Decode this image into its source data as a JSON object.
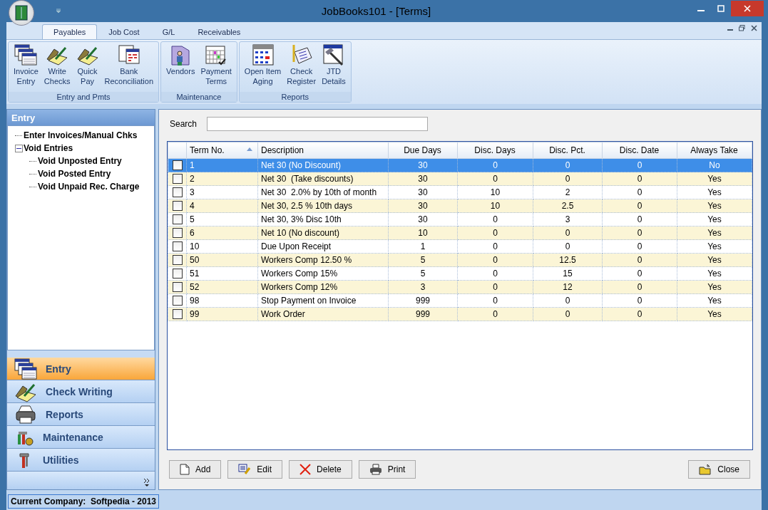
{
  "window": {
    "title": "JobBooks101 - [Terms]"
  },
  "ribbon": {
    "tabs": [
      {
        "label": "Payables",
        "selected": true
      },
      {
        "label": "Job Cost",
        "selected": false
      },
      {
        "label": "G/L",
        "selected": false
      },
      {
        "label": "Receivables",
        "selected": false
      }
    ],
    "groups": [
      {
        "label": "Entry and Pmts",
        "buttons": [
          {
            "lines": [
              "Invoice",
              "Entry"
            ]
          },
          {
            "lines": [
              "Write",
              "Checks"
            ]
          },
          {
            "lines": [
              "Quick",
              "Pay"
            ]
          },
          {
            "lines": [
              "Bank",
              "Reconciliation"
            ]
          }
        ]
      },
      {
        "label": "Maintenance",
        "buttons": [
          {
            "lines": [
              "Vendors"
            ]
          },
          {
            "lines": [
              "Payment",
              "Terms"
            ]
          }
        ]
      },
      {
        "label": "Reports",
        "buttons": [
          {
            "lines": [
              "Open Item",
              "Aging"
            ]
          },
          {
            "lines": [
              "Check",
              "Register"
            ]
          },
          {
            "lines": [
              "JTD",
              "Details"
            ]
          }
        ]
      }
    ]
  },
  "sidebar": {
    "header": "Entry",
    "tree": [
      {
        "label": "Enter Invoices/Manual Chks"
      },
      {
        "label": "Void Entries",
        "expanded": true,
        "children": [
          {
            "label": "Void Unposted Entry"
          },
          {
            "label": "Void Posted Entry"
          },
          {
            "label": "Void Unpaid Rec. Charge"
          }
        ]
      }
    ],
    "nav": [
      {
        "label": "Entry",
        "selected": true
      },
      {
        "label": "Check Writing",
        "selected": false
      },
      {
        "label": "Reports",
        "selected": false
      },
      {
        "label": "Maintenance",
        "selected": false
      },
      {
        "label": "Utilities",
        "selected": false
      }
    ]
  },
  "search": {
    "label": "Search"
  },
  "table": {
    "columns": [
      "Term No.",
      "Description",
      "Due Days",
      "Disc. Days",
      "Disc. Pct.",
      "Disc. Date",
      "Always Take"
    ],
    "rows": [
      {
        "checked": false,
        "selected": true,
        "cells": [
          "1",
          "Net 30 (No Discount)",
          "30",
          "0",
          "0",
          "0",
          "No"
        ]
      },
      {
        "checked": false,
        "selected": false,
        "cells": [
          "2",
          "Net 30  (Take discounts)",
          "30",
          "0",
          "0",
          "0",
          "Yes"
        ]
      },
      {
        "checked": false,
        "selected": false,
        "cells": [
          "3",
          "Net 30  2.0% by 10th of month",
          "30",
          "10",
          "2",
          "0",
          "Yes"
        ]
      },
      {
        "checked": false,
        "selected": false,
        "cells": [
          "4",
          "Net 30, 2.5 % 10th days",
          "30",
          "10",
          "2.5",
          "0",
          "Yes"
        ]
      },
      {
        "checked": false,
        "selected": false,
        "cells": [
          "5",
          "Net 30, 3% Disc 10th",
          "30",
          "0",
          "3",
          "0",
          "Yes"
        ]
      },
      {
        "checked": false,
        "selected": false,
        "cells": [
          "6",
          "Net 10 (No discount)",
          "10",
          "0",
          "0",
          "0",
          "Yes"
        ]
      },
      {
        "checked": false,
        "selected": false,
        "cells": [
          "10",
          "Due Upon Receipt",
          "1",
          "0",
          "0",
          "0",
          "Yes"
        ]
      },
      {
        "checked": false,
        "selected": false,
        "cells": [
          "50",
          "Workers Comp 12.50 %",
          "5",
          "0",
          "12.5",
          "0",
          "Yes"
        ]
      },
      {
        "checked": false,
        "selected": false,
        "cells": [
          "51",
          "Workers Comp 15%",
          "5",
          "0",
          "15",
          "0",
          "Yes"
        ]
      },
      {
        "checked": false,
        "selected": false,
        "cells": [
          "52",
          "Workers Comp 12%",
          "3",
          "0",
          "12",
          "0",
          "Yes"
        ]
      },
      {
        "checked": false,
        "selected": false,
        "cells": [
          "98",
          "Stop Payment on Invoice",
          "999",
          "0",
          "0",
          "0",
          "Yes"
        ]
      },
      {
        "checked": false,
        "selected": false,
        "cells": [
          "99",
          "Work Order",
          "999",
          "0",
          "0",
          "0",
          "Yes"
        ]
      }
    ]
  },
  "buttons": [
    {
      "label": "Add",
      "kind": "add"
    },
    {
      "label": "Edit",
      "kind": "edit"
    },
    {
      "label": "Delete",
      "kind": "delete"
    },
    {
      "label": "Print",
      "kind": "print"
    }
  ],
  "close_button": {
    "label": "Close"
  },
  "status_bar": {
    "text": "Current Company:  Softpedia - 2013"
  }
}
